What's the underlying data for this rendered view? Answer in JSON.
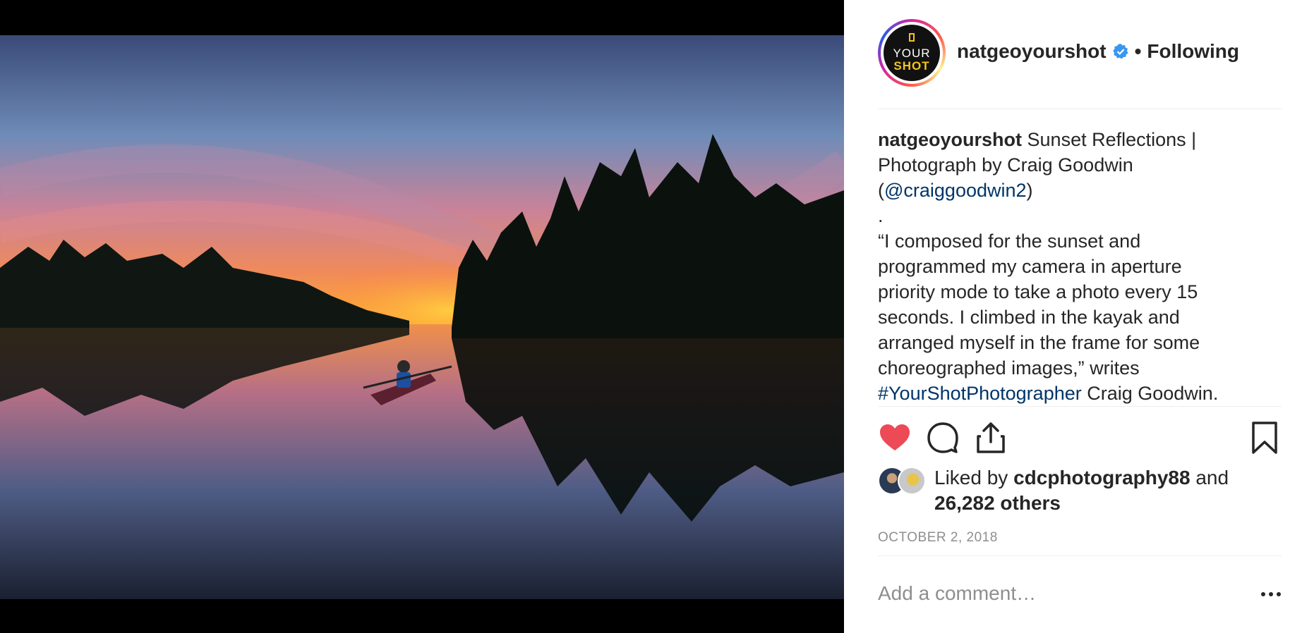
{
  "account": {
    "username": "natgeoyourshot",
    "follow_status": "Following",
    "separator": "•",
    "avatar": {
      "line1": "YOUR",
      "line2": "SHOT"
    }
  },
  "caption": {
    "username": "natgeoyourshot",
    "line1": "Sunset Reflections |",
    "line2": "Photograph by Craig Goodwin",
    "mention_open": "(",
    "mention": "@craiggoodwin2",
    "mention_close": ")",
    "dot": ".",
    "quote_lines": [
      "“I composed for the sunset and",
      "programmed my camera in aperture",
      "priority mode to take a photo every 15",
      "seconds. I climbed in the kayak and",
      "arranged myself in the frame for some",
      "choreographed images,” writes"
    ],
    "hashtag": "#YourShotPhotographer",
    "tail": " Craig Goodwin."
  },
  "likes": {
    "prefix": "Liked by ",
    "user": "cdcphotography88",
    "mid": " and",
    "others": "26,282 others"
  },
  "date": "OCTOBER 2, 2018",
  "comment": {
    "placeholder": "Add a comment…"
  },
  "icons": [
    "heart-icon",
    "comment-icon",
    "share-icon",
    "bookmark-icon",
    "more-options-icon",
    "verified-badge-icon"
  ],
  "colors": {
    "heart": "#ed4956",
    "link": "#003569",
    "verified": "#3897f0",
    "muted": "#8e8e8e"
  }
}
